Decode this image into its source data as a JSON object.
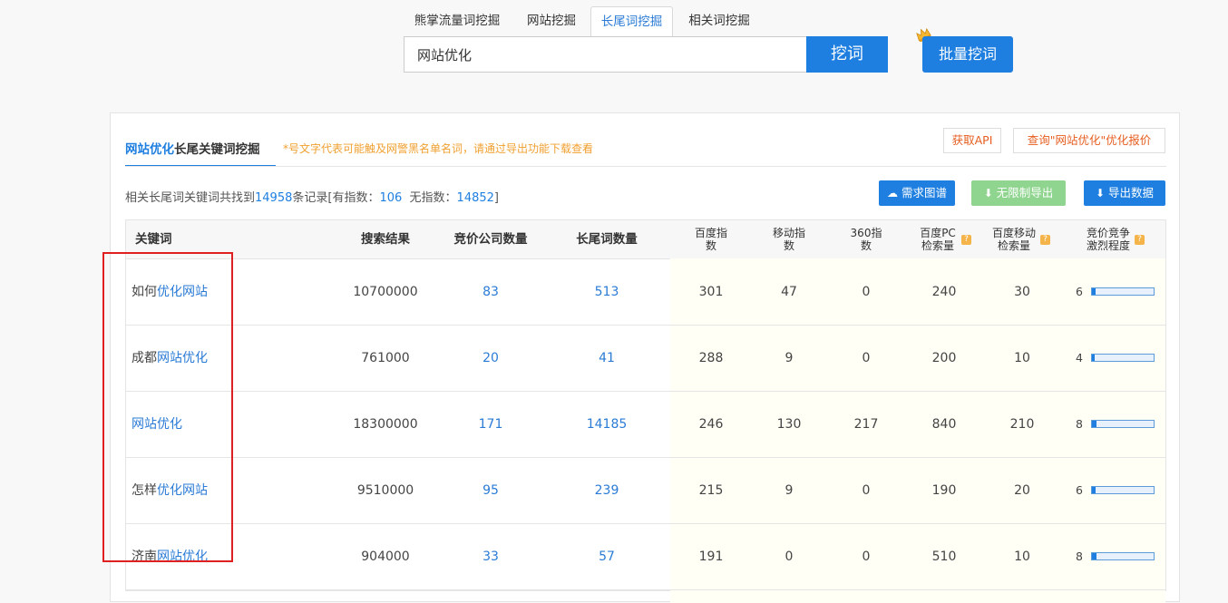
{
  "tabs": [
    {
      "label": "熊掌流量词挖掘",
      "active": false
    },
    {
      "label": "网站挖掘",
      "active": false
    },
    {
      "label": "长尾词挖掘",
      "active": true
    },
    {
      "label": "相关词挖掘",
      "active": false
    }
  ],
  "search": {
    "value": "网站优化",
    "button": "挖词",
    "batch_button": "批量挖词"
  },
  "panel": {
    "title_keyword": "网站优化",
    "title_rest": "长尾关键词挖掘",
    "note": "*号文字代表可能触及网警黑名单名词，请通过导出功能下载查看",
    "api_button": "获取API",
    "quote_button": "查询\"网站优化\"优化报价"
  },
  "stats": {
    "prefix": "相关长尾词关键词共找到",
    "total": "14958",
    "mid": "条记录[有指数：",
    "with_index": "106",
    "mid2": "  无指数：",
    "without_index": "14852",
    "suffix": "]"
  },
  "actions": {
    "demand_chart": "需求图谱",
    "unlimited_export": "无限制导出",
    "export_data": "导出数据"
  },
  "columns": {
    "keyword": "关键词",
    "search_results": "搜索结果",
    "bid_companies": "竞价公司数量",
    "longtail_count": "长尾词数量",
    "baidu_index": "百度指数",
    "mobile_index": "移动指数",
    "index_360": "360指数",
    "baidu_pc": "百度PC检索量",
    "baidu_mobile": "百度移动检索量",
    "competition": "竞价竞争激烈程度"
  },
  "rows": [
    {
      "prefix": "如何",
      "keyword": "优化网站",
      "results": "10700000",
      "bid": "83",
      "longtail": "513",
      "baidu": "301",
      "mobile": "47",
      "i360": "0",
      "pc": "240",
      "mob": "30",
      "comp": "6",
      "comp_level": 0.06
    },
    {
      "prefix": "成都",
      "keyword": "网站优化",
      "results": "761000",
      "bid": "20",
      "longtail": "41",
      "baidu": "288",
      "mobile": "9",
      "i360": "0",
      "pc": "200",
      "mob": "10",
      "comp": "4",
      "comp_level": 0.04
    },
    {
      "prefix": "",
      "keyword": "网站优化",
      "results": "18300000",
      "bid": "171",
      "longtail": "14185",
      "baidu": "246",
      "mobile": "130",
      "i360": "217",
      "pc": "840",
      "mob": "210",
      "comp": "8",
      "comp_level": 0.08
    },
    {
      "prefix": "怎样",
      "keyword": "优化网站",
      "results": "9510000",
      "bid": "95",
      "longtail": "239",
      "baidu": "215",
      "mobile": "9",
      "i360": "0",
      "pc": "190",
      "mob": "20",
      "comp": "6",
      "comp_level": 0.06
    },
    {
      "prefix": "济南",
      "keyword": "网站优化",
      "results": "904000",
      "bid": "33",
      "longtail": "57",
      "baidu": "191",
      "mobile": "0",
      "i360": "0",
      "pc": "510",
      "mob": "10",
      "comp": "8",
      "comp_level": 0.08
    }
  ],
  "colors": {
    "accent": "#1e7fe0",
    "link": "#2b7bd6",
    "note": "#f0a030",
    "api": "#e65d1f",
    "export_disabled": "#8fd48f",
    "highlight_box": "#e02020"
  }
}
